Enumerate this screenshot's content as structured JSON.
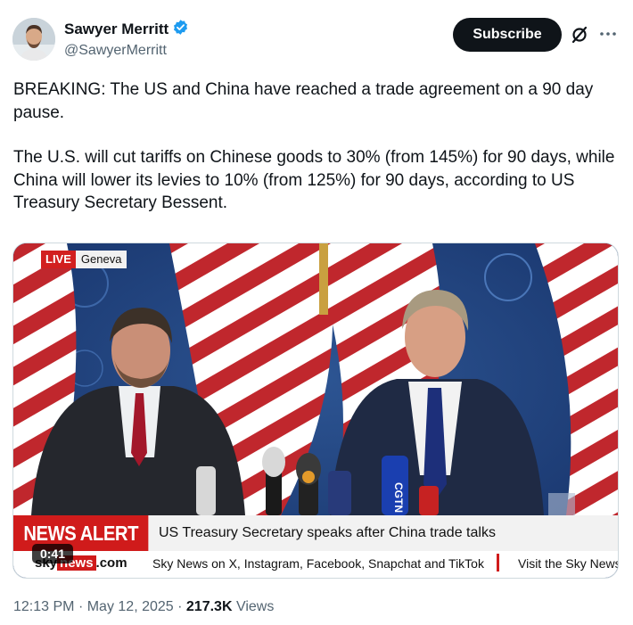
{
  "author": {
    "name": "Sawyer Merritt",
    "handle": "@SawyerMerritt",
    "verified": true,
    "verified_color": "#1d9bf0"
  },
  "actions": {
    "subscribe_label": "Subscribe",
    "grok_icon": "grok-icon",
    "more_icon": "more-icon"
  },
  "tweet": {
    "paragraph1": "BREAKING: The US and China have reached a trade agreement on a 90 day pause.",
    "paragraph2": "The U.S. will cut tariffs on Chinese goods to 30% (from 145%) for 90 days, while China will lower its levies to 10% (from 125%) for 90 days, according to US Treasury Secretary Bessent."
  },
  "video": {
    "live_label": "LIVE",
    "location": "Geneva",
    "alert_label": "NEWS ALERT",
    "headline": "US Treasury Secretary speaks after China trade talks",
    "logo_prefix": "sky",
    "logo_box": "news",
    "logo_suffix": ".com",
    "ticker_text": "Sky News on X, Instagram, Facebook, Snapchat and TikTok",
    "ticker_text2": "Visit the Sky News",
    "timestamp": "0:41",
    "mic_label": "CGTN",
    "alert_color": "#d01b1b"
  },
  "meta": {
    "time": "12:13 PM",
    "separator": "·",
    "date": "May 12, 2025",
    "views_count": "217.3K",
    "views_label": "Views"
  }
}
